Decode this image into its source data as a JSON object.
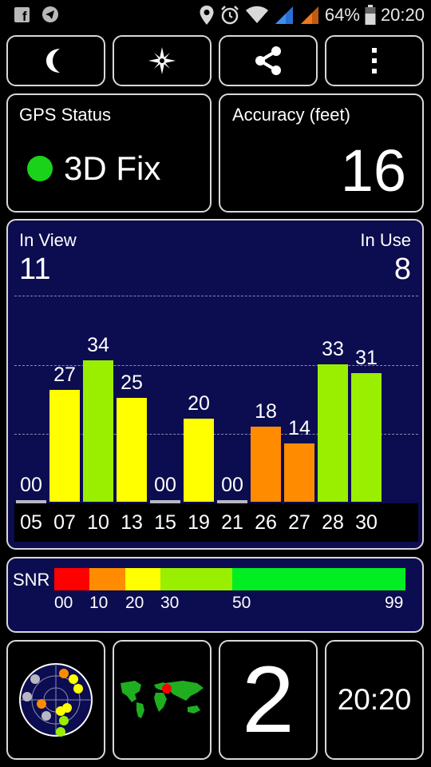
{
  "status_bar": {
    "battery": "64%",
    "time": "20:20",
    "left_icons": [
      "facebook-icon",
      "telegram-icon"
    ],
    "right_icons": [
      "location-icon",
      "alarm-icon",
      "wifi-icon",
      "signal-icon",
      "signal-icon",
      "battery-icon"
    ]
  },
  "toolbar": {
    "buttons": [
      {
        "name": "night-mode-button",
        "icon": "moon-icon"
      },
      {
        "name": "compass-button",
        "icon": "compass-icon"
      },
      {
        "name": "share-button",
        "icon": "share-icon"
      },
      {
        "name": "menu-button",
        "icon": "more-vert-icon"
      }
    ]
  },
  "gps_status": {
    "title": "GPS Status",
    "value": "3D Fix",
    "indicator_color": "#1bd21b"
  },
  "accuracy": {
    "title": "Accuracy (feet)",
    "value": "16"
  },
  "satellites": {
    "in_view_label": "In View",
    "in_view": "11",
    "in_use_label": "In Use",
    "in_use": "8"
  },
  "chart_data": {
    "type": "bar",
    "categories": [
      "05",
      "07",
      "10",
      "13",
      "15",
      "19",
      "21",
      "26",
      "27",
      "28",
      "30"
    ],
    "values": [
      0,
      27,
      34,
      25,
      0,
      20,
      0,
      18,
      14,
      33,
      31
    ],
    "value_labels": [
      "00",
      "27",
      "34",
      "25",
      "00",
      "20",
      "00",
      "18",
      "14",
      "33",
      "31"
    ],
    "ylim": [
      0,
      50
    ],
    "grid": true
  },
  "snr": {
    "label": "SNR",
    "segments": [
      {
        "from": 0,
        "to": 10,
        "color": "#ff0000"
      },
      {
        "from": 10,
        "to": 20,
        "color": "#ff8c00"
      },
      {
        "from": 20,
        "to": 30,
        "color": "#ffff00"
      },
      {
        "from": 30,
        "to": 50,
        "color": "#9aee00"
      },
      {
        "from": 50,
        "to": 99,
        "color": "#00ee22"
      }
    ],
    "ticks": [
      "00",
      "10",
      "20",
      "30",
      "50",
      "99"
    ]
  },
  "bottom": {
    "radar_icon": "sky-view-icon",
    "map_icon": "world-map-icon",
    "big_number": "2",
    "clock": "20:20"
  }
}
